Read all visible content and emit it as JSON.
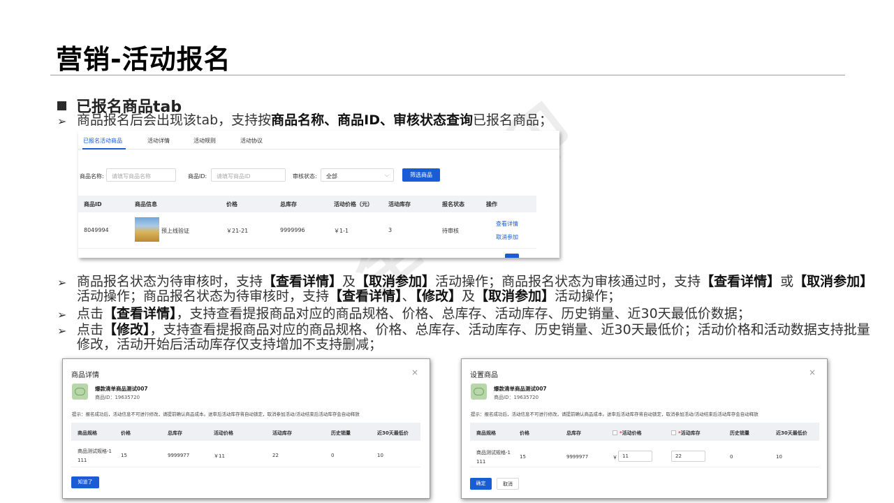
{
  "slide": {
    "title": "营销-活动报名",
    "section": "已报名商品tab"
  },
  "bullets": {
    "b1": {
      "pre": "商品报名后会出现该tab，支持按",
      "bold": "商品名称、商品ID、审核状态查询",
      "post": "已报名商品；"
    },
    "b2": {
      "p1": "商品报名状态为待审核时，支持",
      "k1": "【查看详情】",
      "p2": "及",
      "k2": "【取消参加】",
      "p3": "活动操作；商品报名状态为审核通过时，支持",
      "k3": "【查看详情】",
      "p4": "或",
      "k4": "【取消参加】",
      "p5": "活动操作；商品报名状态为待审核时，支持",
      "k5": "【查看详情】",
      "p6": "、",
      "k6": "【修改】",
      "p7": "及",
      "k7": "【取消参加】",
      "p8": "活动操作；"
    },
    "b3": {
      "p1": "点击",
      "k1": "【查看详情】",
      "p2": "，支持查看提报商品对应的商品规格、价格、总库存、活动库存、历史销量、近30天最低价数据；"
    },
    "b4": {
      "p1": "点击",
      "k1": "【修改】",
      "p2": "，支持查看提报商品对应的商品规格、价格、总库存、活动库存、历史销量、近30天最低价；活动价格和活动数据支持批量修改，活动开始后活动库存仅支持增加不支持删减；"
    }
  },
  "shot1": {
    "tabs": [
      "已报名活动商品",
      "活动详情",
      "活动规则",
      "活动协议"
    ],
    "filters": {
      "name_label": "商品名称:",
      "name_placeholder": "请填写商品名称",
      "id_label": "商品ID:",
      "id_placeholder": "请填写商品ID",
      "status_label": "审核状态:",
      "status_value": "全部",
      "button": "筛选商品"
    },
    "columns": [
      "商品ID",
      "商品信息",
      "价格",
      "总库存",
      "活动价格（元）",
      "活动库存",
      "报名状态",
      "操作"
    ],
    "row": {
      "id": "8049994",
      "name": "预上线验证",
      "price": "￥21-21",
      "stock": "9999996",
      "act_price": "￥1-1",
      "act_stock": "3",
      "status": "待审核",
      "op_view": "查看详情",
      "op_cancel": "取消参加"
    }
  },
  "dialog1": {
    "title": "商品详情",
    "close": "×",
    "product_name": "爆款清单商品测试007",
    "product_id": "商品ID：19635720",
    "tip": "提示：报名成功后，活动信息不可进行修改，请提前确认商品成本。送审后活动库存将自动锁定，取消参加活动/活动结束后活动库存会自动释放",
    "columns": [
      "商品规格",
      "价格",
      "总库存",
      "活动价格",
      "活动库存",
      "历史销量",
      "近30天最低价"
    ],
    "row": {
      "spec1": "商品测试规格-1",
      "spec2": "111",
      "price": "15",
      "stock": "9999977",
      "act_price": "￥11",
      "act_stock": "22",
      "sales": "0",
      "low": "10"
    },
    "ok": "知道了"
  },
  "dialog2": {
    "title": "设置商品",
    "close": "×",
    "product_name": "爆款清单商品测试007",
    "product_id": "商品ID：19635720",
    "tip": "提示：报名成功后，活动信息不可进行修改，请提前确认商品成本。送审后活动库存将自动锁定，取消参加活动/活动结束后活动库存会自动释放",
    "columns": [
      "商品规格",
      "价格",
      "总库存",
      "活动价格",
      "活动库存",
      "历史销量",
      "近30天最低价"
    ],
    "required_mark": "*",
    "currency": "￥",
    "row": {
      "spec1": "商品测试规格-1",
      "spec2": "111",
      "price": "15",
      "stock": "9999977",
      "act_price": "11",
      "act_stock": "22",
      "sales": "0",
      "low": "10"
    },
    "confirm": "确定",
    "cancel": "取消"
  },
  "watermark": "全员水印"
}
